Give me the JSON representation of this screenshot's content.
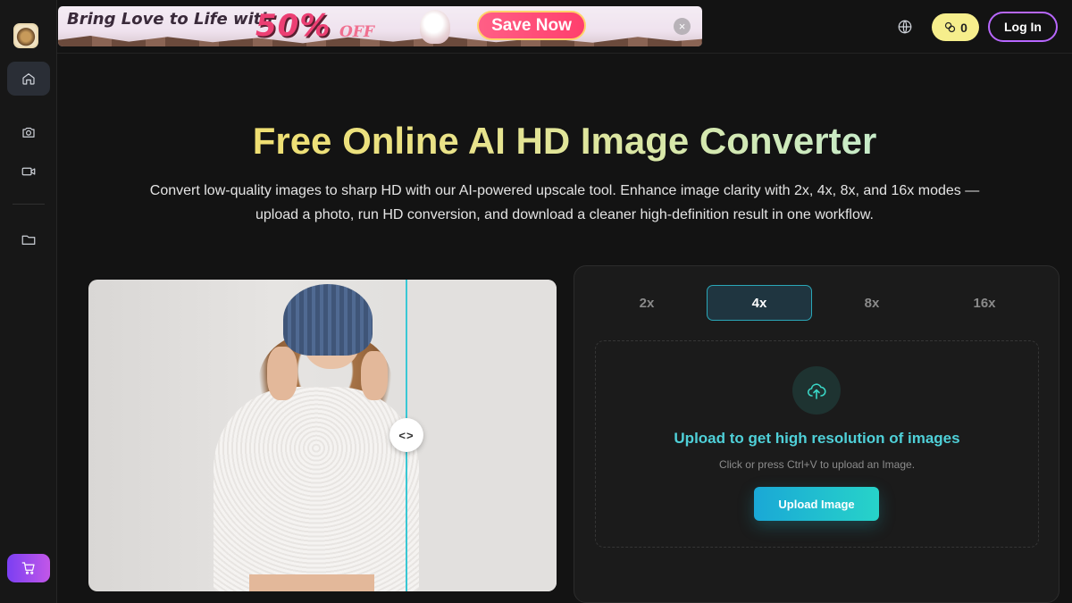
{
  "sidebar": {
    "items": [
      {
        "name": "home",
        "icon": "home-icon",
        "active": true
      },
      {
        "name": "photo",
        "icon": "camera-icon",
        "active": false
      },
      {
        "name": "video",
        "icon": "video-icon",
        "active": false
      },
      {
        "name": "files",
        "icon": "folder-icon",
        "active": false
      }
    ],
    "cart_icon": "cart-icon"
  },
  "banner": {
    "text": "Bring Love to Life with",
    "discount": "50%",
    "off": "OFF",
    "cta": "Save Now",
    "close": "×"
  },
  "header": {
    "credits": "0",
    "login": "Log In",
    "accent": "#b867ff"
  },
  "hero": {
    "title": "Free Online AI HD Image Converter",
    "subtitle": "Convert low-quality images to sharp HD with our AI-powered upscale tool. Enhance image clarity with 2x, 4x, 8x, and 16x modes — upload a photo, run HD conversion, and download a cleaner high-definition result in one workflow."
  },
  "compare": {
    "handle": "<>"
  },
  "upscale": {
    "tabs": [
      "2x",
      "4x",
      "8x",
      "16x"
    ],
    "selected": "4x",
    "upload_title": "Upload to get high resolution of images",
    "upload_hint": "Click or press Ctrl+V to upload an Image.",
    "upload_button": "Upload Image",
    "accent": "#27d3c9"
  }
}
